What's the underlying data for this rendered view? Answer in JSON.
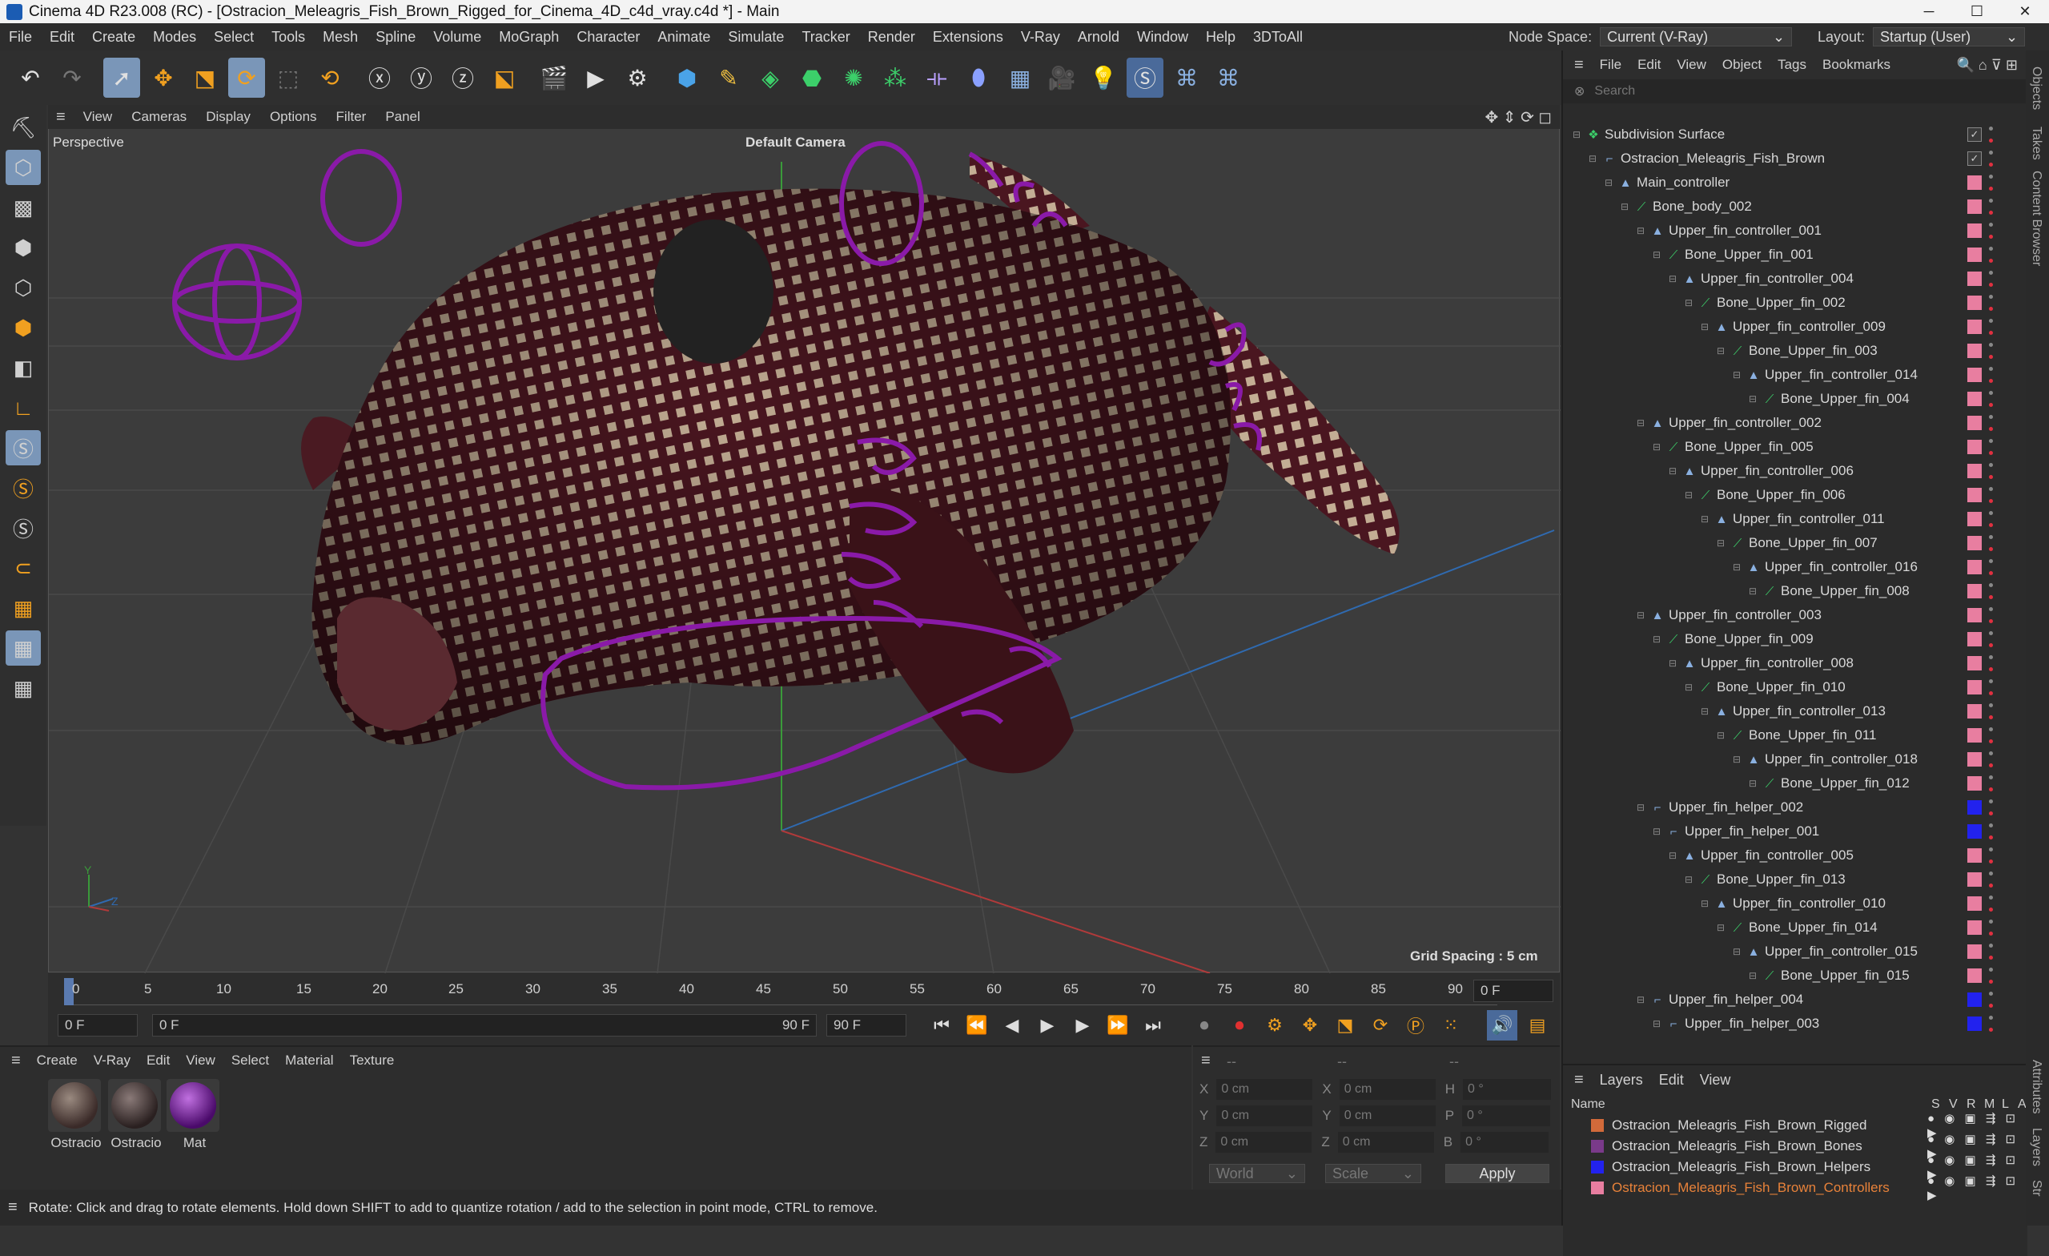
{
  "window": {
    "title": "Cinema 4D R23.008 (RC) - [Ostracion_Meleagris_Fish_Brown_Rigged_for_Cinema_4D_c4d_vray.c4d *] - Main",
    "controls": [
      "─",
      "☐",
      "✕"
    ]
  },
  "menubar": {
    "items": [
      "File",
      "Edit",
      "Create",
      "Modes",
      "Select",
      "Tools",
      "Mesh",
      "Spline",
      "Volume",
      "MoGraph",
      "Character",
      "Animate",
      "Simulate",
      "Tracker",
      "Render",
      "Extensions",
      "V-Ray",
      "Arnold",
      "Window",
      "Help",
      "3DToAll"
    ],
    "node_space_label": "Node Space:",
    "node_space_value": "Current (V-Ray)",
    "layout_label": "Layout:",
    "layout_value": "Startup (User)"
  },
  "viewport": {
    "menu": [
      "View",
      "Cameras",
      "Display",
      "Options",
      "Filter",
      "Panel"
    ],
    "label": "Perspective",
    "camera": "Default Camera",
    "grid_spacing": "Grid Spacing : 5 cm",
    "axis_y": "Y",
    "axis_z": "Z"
  },
  "timeline": {
    "ticks": [
      "0",
      "5",
      "10",
      "15",
      "20",
      "25",
      "30",
      "35",
      "40",
      "45",
      "50",
      "55",
      "60",
      "65",
      "70",
      "75",
      "80",
      "85",
      "90"
    ],
    "current_frame_field": "0 F",
    "start_field": "0 F",
    "range_start": "0 F",
    "range_end": "90 F",
    "end_field": "90 F"
  },
  "materials": {
    "menu": [
      "Create",
      "V-Ray",
      "Edit",
      "View",
      "Select",
      "Material",
      "Texture"
    ],
    "items": [
      {
        "label": "Ostracio",
        "color": "#5a4a45"
      },
      {
        "label": "Ostracio",
        "color": "#4a4040"
      },
      {
        "label": "Mat",
        "color": "#7a1a9a"
      }
    ]
  },
  "coords": {
    "header_left": "--",
    "header_mid": "--",
    "header_right": "--",
    "rows": [
      {
        "a": "X",
        "av": "0 cm",
        "b": "X",
        "bv": "0 cm",
        "c": "H",
        "cv": "0 °"
      },
      {
        "a": "Y",
        "av": "0 cm",
        "b": "Y",
        "bv": "0 cm",
        "c": "P",
        "cv": "0 °"
      },
      {
        "a": "Z",
        "av": "0 cm",
        "b": "Z",
        "bv": "0 cm",
        "c": "B",
        "cv": "0 °"
      }
    ],
    "world": "World",
    "scale": "Scale",
    "apply": "Apply"
  },
  "status": "Rotate: Click and drag to rotate elements. Hold down SHIFT to add to quantize rotation / add to the selection in point mode, CTRL to remove.",
  "objects": {
    "menu": [
      "File",
      "Edit",
      "View",
      "Object",
      "Tags",
      "Bookmarks"
    ],
    "search_placeholder": "Search",
    "rows": [
      {
        "name": "Subdivision Surface",
        "level": 0,
        "type": "subdiv",
        "swatch": "check"
      },
      {
        "name": "Ostracion_Meleagris_Fish_Brown",
        "level": 1,
        "type": "null",
        "swatch": "check"
      },
      {
        "name": "Main_controller",
        "level": 2,
        "type": "ctrl",
        "swatch": "#e87ea0"
      },
      {
        "name": "Bone_body_002",
        "level": 3,
        "type": "bone",
        "swatch": "#e87ea0"
      },
      {
        "name": "Upper_fin_controller_001",
        "level": 4,
        "type": "ctrl",
        "swatch": "#e87ea0"
      },
      {
        "name": "Bone_Upper_fin_001",
        "level": 5,
        "type": "bone",
        "swatch": "#e87ea0"
      },
      {
        "name": "Upper_fin_controller_004",
        "level": 6,
        "type": "ctrl",
        "swatch": "#e87ea0"
      },
      {
        "name": "Bone_Upper_fin_002",
        "level": 7,
        "type": "bone",
        "swatch": "#e87ea0"
      },
      {
        "name": "Upper_fin_controller_009",
        "level": 8,
        "type": "ctrl",
        "swatch": "#e87ea0"
      },
      {
        "name": "Bone_Upper_fin_003",
        "level": 9,
        "type": "bone",
        "swatch": "#e87ea0"
      },
      {
        "name": "Upper_fin_controller_014",
        "level": 10,
        "type": "ctrl",
        "swatch": "#e87ea0"
      },
      {
        "name": "Bone_Upper_fin_004",
        "level": 11,
        "type": "bone",
        "swatch": "#e87ea0"
      },
      {
        "name": "Upper_fin_controller_002",
        "level": 4,
        "type": "ctrl",
        "swatch": "#e87ea0"
      },
      {
        "name": "Bone_Upper_fin_005",
        "level": 5,
        "type": "bone",
        "swatch": "#e87ea0"
      },
      {
        "name": "Upper_fin_controller_006",
        "level": 6,
        "type": "ctrl",
        "swatch": "#e87ea0"
      },
      {
        "name": "Bone_Upper_fin_006",
        "level": 7,
        "type": "bone",
        "swatch": "#e87ea0"
      },
      {
        "name": "Upper_fin_controller_011",
        "level": 8,
        "type": "ctrl",
        "swatch": "#e87ea0"
      },
      {
        "name": "Bone_Upper_fin_007",
        "level": 9,
        "type": "bone",
        "swatch": "#e87ea0"
      },
      {
        "name": "Upper_fin_controller_016",
        "level": 10,
        "type": "ctrl",
        "swatch": "#e87ea0"
      },
      {
        "name": "Bone_Upper_fin_008",
        "level": 11,
        "type": "bone",
        "swatch": "#e87ea0"
      },
      {
        "name": "Upper_fin_controller_003",
        "level": 4,
        "type": "ctrl",
        "swatch": "#e87ea0"
      },
      {
        "name": "Bone_Upper_fin_009",
        "level": 5,
        "type": "bone",
        "swatch": "#e87ea0"
      },
      {
        "name": "Upper_fin_controller_008",
        "level": 6,
        "type": "ctrl",
        "swatch": "#e87ea0"
      },
      {
        "name": "Bone_Upper_fin_010",
        "level": 7,
        "type": "bone",
        "swatch": "#e87ea0"
      },
      {
        "name": "Upper_fin_controller_013",
        "level": 8,
        "type": "ctrl",
        "swatch": "#e87ea0"
      },
      {
        "name": "Bone_Upper_fin_011",
        "level": 9,
        "type": "bone",
        "swatch": "#e87ea0"
      },
      {
        "name": "Upper_fin_controller_018",
        "level": 10,
        "type": "ctrl",
        "swatch": "#e87ea0"
      },
      {
        "name": "Bone_Upper_fin_012",
        "level": 11,
        "type": "bone",
        "swatch": "#e87ea0"
      },
      {
        "name": "Upper_fin_helper_002",
        "level": 4,
        "type": "null",
        "swatch": "#2222ee"
      },
      {
        "name": "Upper_fin_helper_001",
        "level": 5,
        "type": "null",
        "swatch": "#2222ee"
      },
      {
        "name": "Upper_fin_controller_005",
        "level": 6,
        "type": "ctrl",
        "swatch": "#e87ea0"
      },
      {
        "name": "Bone_Upper_fin_013",
        "level": 7,
        "type": "bone",
        "swatch": "#e87ea0"
      },
      {
        "name": "Upper_fin_controller_010",
        "level": 8,
        "type": "ctrl",
        "swatch": "#e87ea0"
      },
      {
        "name": "Bone_Upper_fin_014",
        "level": 9,
        "type": "bone",
        "swatch": "#e87ea0"
      },
      {
        "name": "Upper_fin_controller_015",
        "level": 10,
        "type": "ctrl",
        "swatch": "#e87ea0"
      },
      {
        "name": "Bone_Upper_fin_015",
        "level": 11,
        "type": "bone",
        "swatch": "#e87ea0"
      },
      {
        "name": "Upper_fin_helper_004",
        "level": 4,
        "type": "null",
        "swatch": "#2222ee"
      },
      {
        "name": "Upper_fin_helper_003",
        "level": 5,
        "type": "null",
        "swatch": "#2222ee"
      }
    ]
  },
  "layers": {
    "menu": [
      "Layers",
      "Edit",
      "View"
    ],
    "col_name": "Name",
    "col_flags": [
      "S",
      "V",
      "R",
      "M",
      "L",
      "A"
    ],
    "items": [
      {
        "name": "Ostracion_Meleagris_Fish_Brown_Rigged",
        "color": "#d26a3a",
        "active": false
      },
      {
        "name": "Ostracion_Meleagris_Fish_Brown_Bones",
        "color": "#7a3a8a",
        "active": false
      },
      {
        "name": "Ostracion_Meleagris_Fish_Brown_Helpers",
        "color": "#2222ee",
        "active": false
      },
      {
        "name": "Ostracion_Meleagris_Fish_Brown_Controllers",
        "color": "#e87ea0",
        "active": true
      }
    ]
  },
  "side_tabs": [
    "Objects",
    "Takes",
    "Content Browser",
    "Attributes",
    "Layers",
    "Str"
  ],
  "colors": {
    "accent": "#7a96b8",
    "rig_purple": "#8a1aa8",
    "active_layer": "#e8823a"
  }
}
